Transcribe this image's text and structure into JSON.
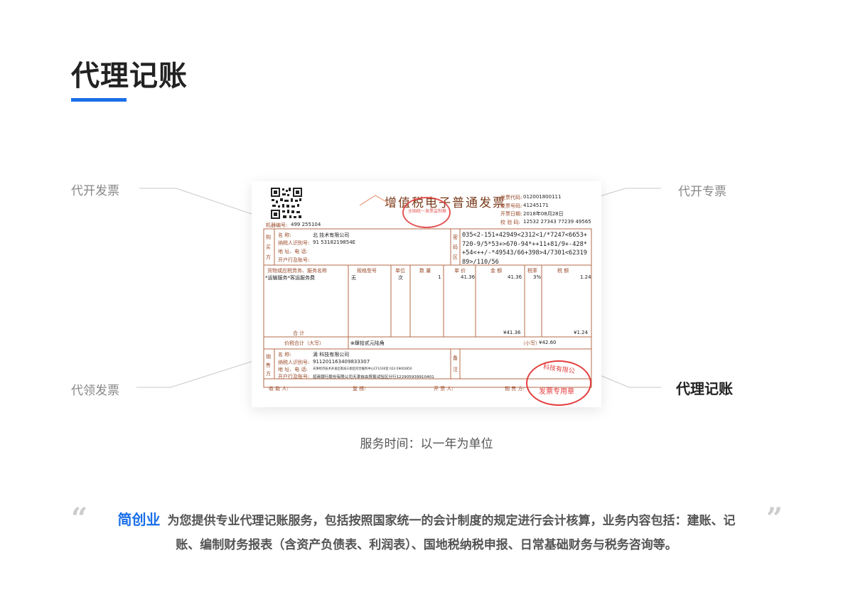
{
  "page": {
    "title": "代理记账",
    "accent_color": "#1a6fe8"
  },
  "callouts": {
    "top_left": "代开发票",
    "top_right": "代开专票",
    "bottom_left": "代领发票",
    "bottom_right": "代理记账"
  },
  "invoice": {
    "title": "增值税电子普通发票",
    "code_label": "发票代码:",
    "code": "012001800111",
    "number_label": "发票号码:",
    "number": "41245171",
    "date_label": "开票日期:",
    "date": "2018年08月28日",
    "check_label": "校 验 码:",
    "check_code": "12532 27343 77239 49565",
    "machine_label": "机器编号:",
    "machine_no": "499        255104",
    "buyer_section": "购买方",
    "buyer_name_label": "名          称:",
    "buyer_name": "北          技术有限公司",
    "buyer_taxid_label": "纳税人识别号:",
    "buyer_taxid": "91          5318219854E",
    "buyer_address_label": "地 址、电 话:",
    "buyer_bank_label": "开户行及账号:",
    "cipher_area": "密码区",
    "cipher_text": "035<2-151+42949<2312<1/*7247<6653+720-9/5*53+>670-94*++11+81/9+-428*+54<++/-*49543/66+398>4/7301<6231989>/110/56",
    "col_item": "货物或应税劳务、服务名称",
    "col_model": "规格型号",
    "col_unit": "单位",
    "col_qty": "数 量",
    "col_price": "单 价",
    "col_amount": "金 额",
    "col_rate": "税率",
    "col_tax": "税 额",
    "item_name": "*运输服务*客运服务费",
    "item_model": "无",
    "item_unit": "次",
    "item_qty": "1",
    "item_price": "41.36",
    "item_amount": "41.36",
    "item_rate": "3%",
    "item_tax": "1.24",
    "total_label": "合          计",
    "total_amount": "¥41.36",
    "total_tax": "¥1.24",
    "grand_label": "价税合计（大写）",
    "grand_words": "⊗肆拾贰元陆角",
    "grand_small_label": "（小写）",
    "grand_small": "¥42.60",
    "seller_section": "销售方",
    "seller_name_label": "名          称:",
    "seller_name": "滴        科技有限公司",
    "seller_taxid_label": "纳税人识别号:",
    "seller_taxid": "911201163409833307",
    "seller_address_label": "地 址、电 话:",
    "seller_address": "天津经济技术开发区南海三街区综合服务中心CF1030室 022-59002850",
    "seller_bank_label": "开户行及账号:",
    "seller_bank": "招商银行股份有限公司天津自由贸易试验区分行122905939910401",
    "remark_label": "备注",
    "payee_label": "收 款 人:",
    "payee": "       ",
    "reviewer_label": "复 核:",
    "issuer_label": "开 票 人:",
    "seller_label": "销 售 方:",
    "seal_top": "科技有限公",
    "seal_bottom": "发票专用章",
    "tax_seal": "全国统一发票监制章"
  },
  "service_time": "服务时间：以一年为单位",
  "description": {
    "brand": "简创业",
    "text": "为您提供专业代理记账服务，包括按照国家统一的会计制度的规定进行会计核算，业务内容包括：建账、记账、编制财务报表（含资产负债表、利润表）、国地税纳税申报、日常基础财务与税务咨询等。",
    "open_quote": "“",
    "close_quote": "”"
  }
}
